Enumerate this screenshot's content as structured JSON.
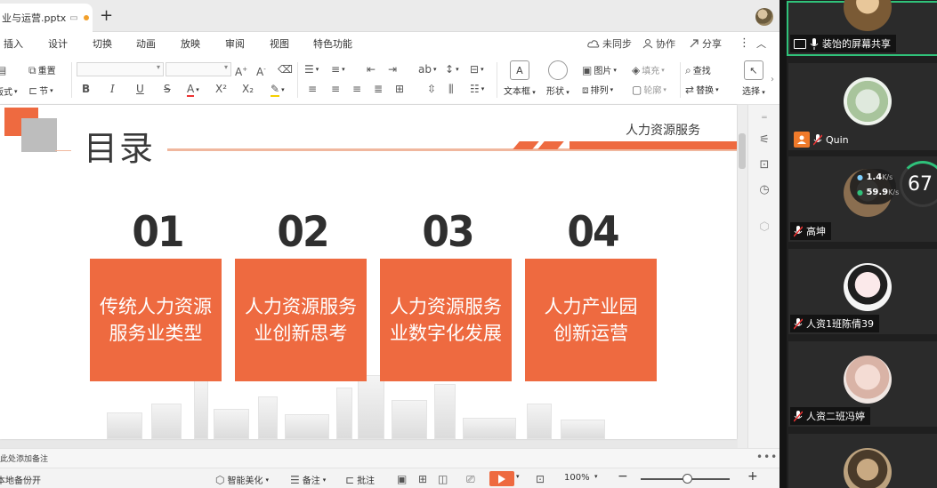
{
  "app": {
    "doc_tab_title": "业与运营.pptx",
    "new_tab_symbol": "+"
  },
  "menu": {
    "items": [
      "插入",
      "设计",
      "切换",
      "动画",
      "放映",
      "审阅",
      "视图",
      "特色功能"
    ],
    "sync_label": "未同步",
    "collab_label": "协作",
    "share_label": "分享"
  },
  "ribbon": {
    "reset_label": "重置",
    "layout_label": "版式",
    "section_label": "节",
    "textbox_label": "文本框",
    "shape_label": "形状",
    "picture_label": "图片",
    "arrange_label": "排列",
    "fill_label": "填充",
    "outline_label": "轮廓",
    "find_label": "查找",
    "replace_label": "替换",
    "select_label": "选择"
  },
  "slide": {
    "title": "目录",
    "header": "人力资源服务",
    "items": [
      {
        "number": "01",
        "line1": "传统人力资源",
        "line2": "服务业类型"
      },
      {
        "number": "02",
        "line1": "人力资源服务",
        "line2": "业创新思考"
      },
      {
        "number": "03",
        "line1": "人力资源服务",
        "line2": "业数字化发展"
      },
      {
        "number": "04",
        "line1": "人力产业园",
        "line2": "创新运营"
      }
    ]
  },
  "notes": {
    "placeholder": "此处添加备注"
  },
  "statusbar": {
    "backup_label": "本地备份开",
    "beautify_label": "智能美化",
    "notes_label": "备注",
    "comment_label": "批注",
    "zoom_label": "100%"
  },
  "meeting": {
    "participants": [
      {
        "name": "装饴的屏幕共享",
        "sharing": true
      },
      {
        "name": "Quin",
        "host": true
      },
      {
        "name": "高坤"
      },
      {
        "name": "人资1班陈倩39"
      },
      {
        "name": "人资二班冯婷"
      }
    ],
    "net_up": "1.4",
    "net_down": "59.9",
    "net_unit": "K/s",
    "gauge_value": "67"
  },
  "colors": {
    "accent_orange": "#ee6a40",
    "meeting_active": "#30c27a"
  }
}
